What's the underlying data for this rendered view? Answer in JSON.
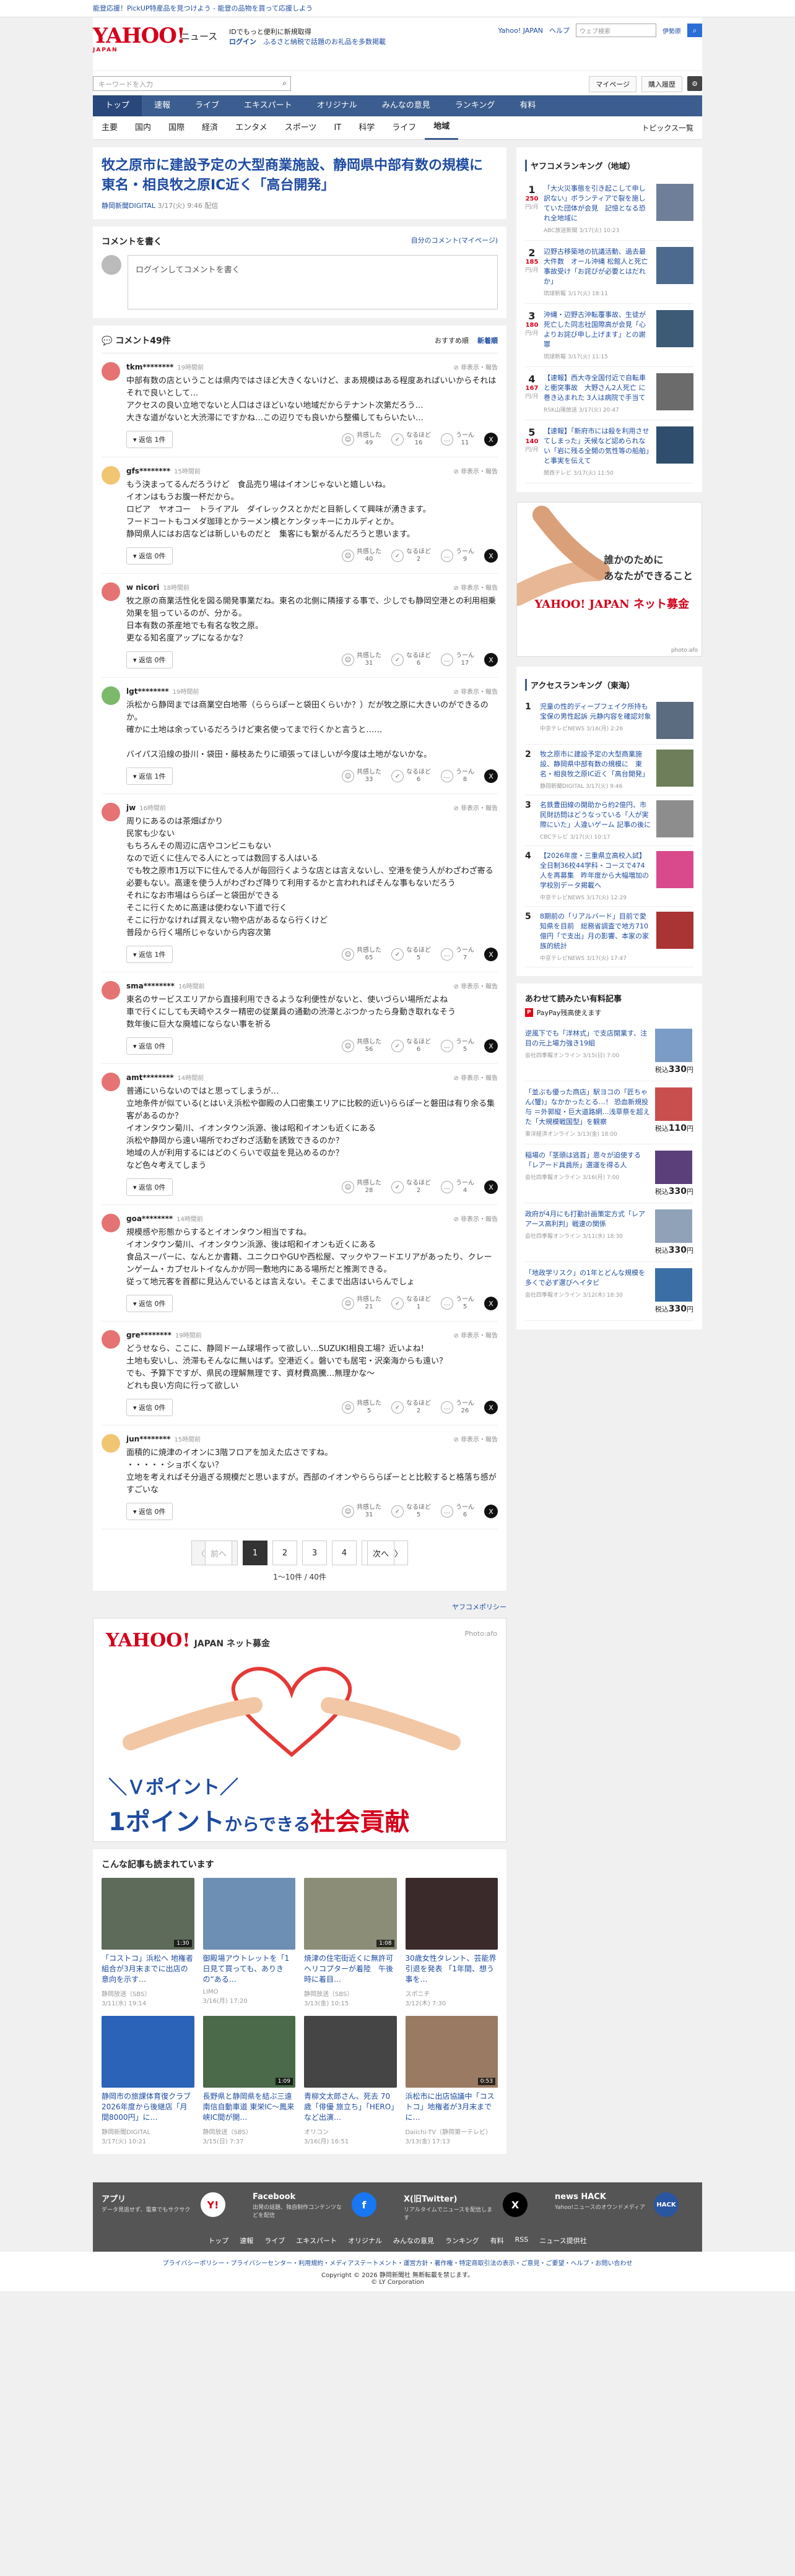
{
  "promo_text": "能登応援！PickUP特産品を見つけよう - 能登の品物を買って応援しよう",
  "header": {
    "logo": "YAHOO!",
    "logo_sub": "JAPAN",
    "service": "ニュース",
    "msg1": "IDでもっと便利に新規取得",
    "msg2_login": "ログイン",
    "msg2_rest": "ふるさと納税で話題のお礼品を多数掲載",
    "top_links": [
      "Yahoo! JAPAN",
      "ヘルプ"
    ],
    "search_placeholder": "ウェブ検索",
    "location": "伊勢原"
  },
  "search": {
    "placeholder": "キーワードを入力",
    "mypage": "マイページ",
    "settings": "購入履歴"
  },
  "main_nav": [
    "トップ",
    "速報",
    "ライブ",
    "エキスパート",
    "オリジナル",
    "みんなの意見",
    "ランキング",
    "有料"
  ],
  "sub_nav": [
    "主要",
    "国内",
    "国際",
    "経済",
    "エンタメ",
    "スポーツ",
    "IT",
    "科学",
    "ライフ",
    "地域"
  ],
  "topics_link": "トピックス一覧",
  "article": {
    "title": "牧之原市に建設予定の大型商業施設、静岡県中部有数の規模に　東名・相良牧之原IC近く「高台開発」",
    "source": "静岡新聞DIGITAL",
    "date": "3/17(火) 9:46 配信"
  },
  "comment_write": {
    "title": "コメントを書く",
    "own_link": "自分のコメント(マイページ)",
    "placeholder": "ログインしてコメントを書く"
  },
  "comments_header": {
    "title": "コメント49件",
    "sort_recommend": "おすすめ順",
    "sort_new": "新着順"
  },
  "comments": [
    {
      "user": "tkm********",
      "time": "19時間前",
      "text": "中部有数の店ということは県内ではさほど大きくないけど、まあ規模はある程度あればいいからそれはそれで良いとして…\nアクセスの良い立地でないと人口はさほどいない地域だからテナント次第だろう…\n大きな道がないと大渋滞にですかね…この辺りでも良いから整備してもらいたい…",
      "reply": "返信 1件",
      "v1": "49",
      "v2": "16",
      "v3": "11",
      "color": "#e57373"
    },
    {
      "user": "gfs********",
      "time": "15時間前",
      "text": "もう決まってるんだろうけど　食品売り場はイオンじゃないと嬉しいね。\nイオンはもうお腹一杯だから。\nロピア　ヤオコー　トライアル　ダイレックスとかだと目新しくて興味が湧きます。\nフードコートもコメダ珈琲とかラーメン横とケンタッキーにカルディとか。\n静岡県人にはお店などは新しいものだと　集客にも繋がるんだろうと思います。",
      "reply": "返信 0件",
      "v1": "40",
      "v2": "2",
      "v3": "9",
      "color": "#f0c674"
    },
    {
      "user": "w nicori",
      "time": "18時間前",
      "text": "牧之原の商業活性化を図る開発事業だね。東名の北側に隣接する事で、少しでも静岡空港との利用相乗効果を狙っているのが、分かる。\n日本有数の茶産地でも有名な牧之原。\n更なる知名度アップになるかな？",
      "reply": "返信 0件",
      "v1": "31",
      "v2": "6",
      "v3": "17",
      "color": "#e57373"
    },
    {
      "user": "lgt********",
      "time": "19時間前",
      "text": "浜松から静岡までは商業空白地帯（らららぽーと袋田くらいか？）だが牧之原に大きいのができるのか。\n確かに土地は余っているだろうけど東名使ってまで行くかと言うと……\n\nバイパス沿線の掛川・袋田・藤枝あたりに頑張ってほしいが今度は土地がないかな。",
      "reply": "返信 1件",
      "v1": "33",
      "v2": "6",
      "v3": "8",
      "color": "#7cb96b"
    },
    {
      "user": "jw",
      "time": "16時間前",
      "text": "周りにあるのは茶畑ばかり\n民家も少ない\nもちろんその周辺に店やコンビニもない\nなので近くに住んでる人にとっては数回する人はいる\nでも牧之原市1万以下に住んでる人が毎回行くような店とは言えないし、空港を使う人がわざわざ寄る必要もない。高速を使う人がわざわざ降りて利用するかと言われればそんな事もないだろう\nそれになお市場はららぽーと袋田ができる\nそこに行くために高速は使わない下道で行く\nそこに行かなければ買えない物や店があるなら行くけど\n普段から行く場所じゃないから内容次第",
      "reply": "返信 1件",
      "v1": "65",
      "v2": "5",
      "v3": "7",
      "color": "#e57373"
    },
    {
      "user": "sma********",
      "time": "16時間前",
      "text": "東名のサービスエリアから直接利用できるような利便性がないと、使いづらい場所だよね\n車で行くにしても天崎やスター精密の従業員の通勤の渋滞とぶつかったら身動き取れなそう\n数年後に巨大な廃墟にならない事を祈る",
      "reply": "返信 0件",
      "v1": "56",
      "v2": "6",
      "v3": "5",
      "color": "#e57373"
    },
    {
      "user": "amt********",
      "time": "14時間前",
      "text": "普通にいらないのではと思ってしまうが…\n立地条件が似ている(とはいえ浜松や御殿の人口密集エリアに比較的近い)ららぽーと磐田は有り余る集客があるのか？\nイオンタウン菊川、イオンタウン浜源、後は昭和イオンも近くにある\n浜松や静岡から遠い場所でわざわざ活動を誘致できるのか？\n地域の人が利用するにはどのくらいで収益を見込めるのか？\nなど色々考えてしまう",
      "reply": "返信 0件",
      "v1": "28",
      "v2": "2",
      "v3": "4",
      "color": "#e57373"
    },
    {
      "user": "goa********",
      "time": "14時間前",
      "text": "規模感や形態からするとイオンタウン相当ですね。\nイオンタウン菊川、イオンタウン浜源、後は昭和イオンも近くにある\n食品スーパーに、なんとか書籍、ユニクロやGUや西松屋、マックやフードエリアがあったり、クレーンゲーム・カプセルトイなんかが同一敷地内にある場所だと推測できる。\n従って地元客を首都に見込んでいるとは言えない。そこまで出店はいらんでしょ",
      "reply": "返信 0件",
      "v1": "21",
      "v2": "1",
      "v3": "5",
      "color": "#e57373"
    },
    {
      "user": "gre********",
      "time": "19時間前",
      "text": "どうせなら、ここに、静岡ドーム球場作って欲しい…SUZUKI相良工場？近いよね!\n土地も安いし、渋滞もそんなに無いはず。空港近く。磐いでも居宅・沢楽海からも遠い？\nでも、予算下ですが、県民の理解無理です、資材費高騰…無理かな〜\nどれも良い方向に行って欲しい",
      "reply": "返信 0件",
      "v1": "5",
      "v2": "2",
      "v3": "26",
      "color": "#e57373"
    },
    {
      "user": "jun********",
      "time": "15時間前",
      "text": "面積的に焼津のイオンに3階フロアを加えた広さですね。\n・・・・・ショボくない？\n立地を考えればそ分過ぎる規模だと思いますが。西部のイオンやらららぽーとと比較すると格落ち感がすごいな",
      "reply": "返信 0件",
      "v1": "31",
      "v2": "5",
      "v3": "6",
      "color": "#f0c674"
    }
  ],
  "comment_labels": {
    "report": "非表示・報告",
    "v1": "共感した",
    "v2": "なるほど",
    "v3": "うーん"
  },
  "pager": {
    "prev": "前へ",
    "pages": [
      "1",
      "2",
      "3",
      "4"
    ],
    "next": "次へ",
    "count_text": "1〜10件 / 40件"
  },
  "policy_link": "ヤフコメポリシー",
  "big_ad": {
    "logo": "YAHOO!",
    "logo_sub": "JAPAN ネット募金",
    "credit": "Photo:afo",
    "line1": "＼Ｖポイント／",
    "line2a": "1ポイント",
    "line2b": "からできる",
    "line2c": "社会貢献"
  },
  "related": {
    "title": "こんな記事も読まれています",
    "items": [
      {
        "t": "「コストコ」浜松へ 地権者組合が3月末までに出店の意向を示す…",
        "s": "静岡放送（SBS）",
        "d": "3/11(水) 19:14",
        "dur": "1:30",
        "c": "#5f6b5a"
      },
      {
        "t": "御殿場アウトレットを「1日見て買っても、ありきの“ある…",
        "s": "LIMO",
        "d": "3/16(月) 17:20",
        "dur": "",
        "c": "#6d8fb3"
      },
      {
        "t": "焼津の住宅街近くに無許可ヘリコプターが着陸　午後時に着目…",
        "s": "静岡放送（SBS）",
        "d": "3/13(金) 10:15",
        "dur": "1:08",
        "c": "#8b8d76"
      },
      {
        "t": "30歳女性タレント、芸能界引退を発表 「1年間、想う事を…",
        "s": "スポニチ",
        "d": "3/12(木) 7:30",
        "dur": "",
        "c": "#3b2a2a"
      },
      {
        "t": "静岡市の旅課体育復クラブ 2026年度から後継店「月間8000円」に…",
        "s": "静岡新聞DIGITAL",
        "d": "3/17(火) 10:21",
        "dur": "",
        "c": "#2a63b8"
      },
      {
        "t": "長野県と静岡県を結ぶ三遠南信自動車道 東栄IC〜鳳来峡IC間が開…",
        "s": "静岡放送（SBS）",
        "d": "3/15(日) 7:37",
        "dur": "1:09",
        "c": "#4a6a4a"
      },
      {
        "t": "青柳文太郎さん、死去 70歳「俳優 旅立ち」「HERO」など出演…",
        "s": "オリコン",
        "d": "3/16(月) 16:51",
        "dur": "",
        "c": "#454545"
      },
      {
        "t": "浜松市に出店協議中「コストコ」地権者が3月末までに…",
        "s": "Daiichi-TV（静岡第一テレビ）",
        "d": "3/13(金) 17:13",
        "dur": "0:53",
        "c": "#9a7a63"
      }
    ]
  },
  "sidebar": {
    "ranking_title": "ヤフコメランキング（地域）",
    "ranking": [
      {
        "n": "1",
        "cnt": "250",
        "t": "「大火災事態を引き起こして申し訳ない」ボランティアで裂を施していた団体が会見　記憶となる恐れ全地域に",
        "s": "ABC放送新聞 3/17(火) 10:23",
        "c": "#6f7f99"
      },
      {
        "n": "2",
        "cnt": "185",
        "t": "辺野古移築地の抗議活動、過去最大件数　オール沖縄 松館人と死亡事故受け「お詫びが必要とはだれか」",
        "s": "琉球新報 3/17(火) 18:11",
        "c": "#4c6a8d"
      },
      {
        "n": "3",
        "cnt": "180",
        "t": "沖縄・辺野古沖転覆事故、生徒が死亡した同志社国際高が会見「心よりお詫び申し上げます」との謝罪",
        "s": "琉球新報 3/17(火) 11:15",
        "c": "#3d5a77"
      },
      {
        "n": "4",
        "cnt": "167",
        "t": "【速報】西大寺全国付近で自転車と衝突事故　大野さん2人死亡 に巻き込まれた 3人は病院で手当て",
        "s": "RSK山陽放送 3/17(火) 20:47",
        "c": "#6b6b6b"
      },
      {
        "n": "5",
        "cnt": "140",
        "t": "【速報】「新府市には殺を利用させてしまった」天候など認められない「岩に残る全開の気性等の船舶」と事実を伝えて",
        "s": "関西テレビ 3/17(火) 11:50",
        "c": "#2f4e6d"
      }
    ],
    "ad_msg1": "誰かのために",
    "ad_msg2": "あなたができること",
    "ad_logo": "YAHOO! JAPAN ネット募金",
    "ad_credit": "photo:afo",
    "access_title": "アクセスランキング（東海）",
    "access": [
      {
        "n": "1",
        "t": "児童の性的ディープフェイク所持も宝保の男性起訴 元静内容を確認対象",
        "s": "中京テレビNEWS 3/16(月) 2:26",
        "c": "#5b6c80"
      },
      {
        "n": "2",
        "t": "牧之原市に建設予定の大型商業施設、静岡県中部有数の規模に　東名・相良牧之原IC近く「高台開発」",
        "s": "静岡新聞DIGITAL 3/17(火) 9:46",
        "c": "#6e7e5a"
      },
      {
        "n": "3",
        "t": "名鉄豊田線の開助から約2億円、市民財訪問はどうなっている「人が実際にいた」人違いゲーム 記事の後に",
        "s": "CBCテレビ 3/17(火) 10:17",
        "c": "#8d8d8d"
      },
      {
        "n": "4",
        "t": "【2026年度・三重県立高校入試】全日制36校44学科・コースで474人を再募集　昨年度から大幅増加の学校別データ掲載へ",
        "s": "中京テレビNEWS 3/17(火) 12:29",
        "c": "#d94a8c"
      },
      {
        "n": "5",
        "t": "8期前の「リアルバード」目前で愛知県を目前　総務省調査で地方710億円「で支出」月の影響、本家の家族的統計",
        "s": "中京テレビNEWS 3/17(火) 17:47",
        "c": "#a33"
      }
    ],
    "shop_title": "あわせて読みたい有料記事",
    "paypay": "PayPay残高使えます",
    "shop": [
      {
        "t": "逆風下でも「洋林式」で支店開業す、注目の元上場力強き19組",
        "s": "会社四季報オンライン 3/15(日) 7:00",
        "p": "330",
        "c": "#7a9cc6"
      },
      {
        "t": "「並ぶも優った商店」駅ヨコの「匠ちゃん(蟹)」なかかったとる…！ 恐血新規投与 ＝外郭縦・巨大道路網…浅草祭を超えた「大規模戦国型」を観察",
        "s": "東洋経済オンライン 3/13(金) 18:00",
        "p": "110",
        "c": "#c94f4f"
      },
      {
        "t": "稲場の「茎頭は逃首」恩々が迫使する「レアード具員所」選運を得る人",
        "s": "会社四季報オンライン 3/16(月) 7:00",
        "p": "330",
        "c": "#5a3f7a"
      },
      {
        "t": "政府が4月にも打勤計画策定方式「レアアース高利判」戦速の関係",
        "s": "会社四季報オンライン 3/11(水) 18:30",
        "p": "330",
        "c": "#8fa2b8"
      },
      {
        "t": "「地政学リスク」の1年とどんな規模を多くで必ず選びへイタビ",
        "s": "会社四季報オンライン 3/12(木) 18:30",
        "p": "330",
        "c": "#3a6ea5"
      }
    ],
    "yen": "円/月",
    "tax_in": "税込"
  },
  "footer": {
    "apps": [
      {
        "t": "アプリ",
        "d": "データ見逃せず、電車でもサクサク",
        "icon": "Y!",
        "bg": "#fff",
        "fg": "#d4001a"
      },
      {
        "t": "Facebook",
        "d": "出発の話題、独自制作コンテンツなどを配信",
        "icon": "f",
        "bg": "#1877f2",
        "fg": "#fff"
      },
      {
        "t": "X(旧Twitter)",
        "d": "リアルタイムでニュースを配信します",
        "icon": "X",
        "bg": "#000",
        "fg": "#fff"
      },
      {
        "t": "news HACK",
        "d": "Yahoo!ニュースのオウンドメディア",
        "icon": "HACK",
        "bg": "#2a55a0",
        "fg": "#fff"
      }
    ],
    "nav": [
      "トップ",
      "速報",
      "ライブ",
      "エキスパート",
      "オリジナル",
      "みんなの意見",
      "ランキング",
      "有料",
      "RSS",
      "ニュース提供社"
    ],
    "links": "プライバシーポリシー・プライバシーセンター・利用規約・メディアステートメント・運営方針・著作権・特定商取引法の表示・ご意見・ご要望・ヘルプ・お問い合わせ",
    "copyright1": "Copyright © 2026 静岡新聞社 無断転載を禁じます。",
    "copyright2": "© LY Corporation"
  }
}
